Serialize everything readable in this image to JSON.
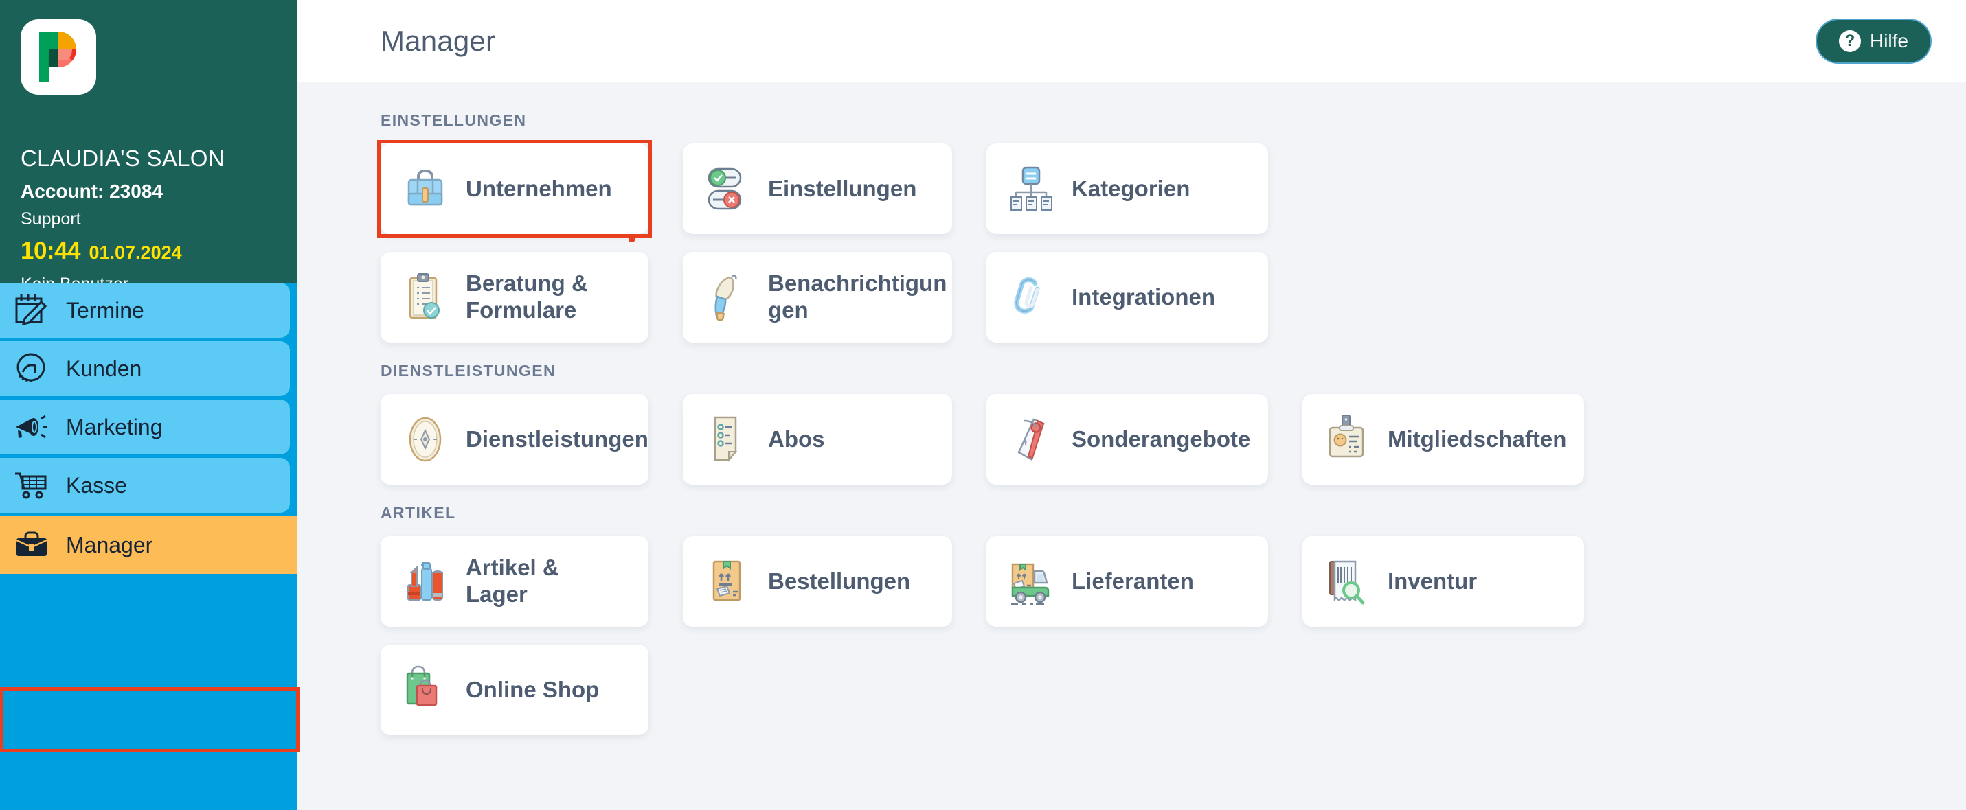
{
  "sidebar": {
    "logo_icon": "pocket-logo-icon",
    "business_name": "CLAUDIA'S SALON",
    "account_label": "Account: 23084",
    "support_label": "Support",
    "clock": "10:44",
    "date": "01.07.2024",
    "user_status": "Kein Benutzer",
    "nav_items": [
      {
        "label": "Termine",
        "icon": "calendar-edit-icon"
      },
      {
        "label": "Kunden",
        "icon": "customer-head-icon"
      },
      {
        "label": "Marketing",
        "icon": "megaphone-icon"
      },
      {
        "label": "Kasse",
        "icon": "shopping-cart-icon"
      },
      {
        "label": "Manager",
        "icon": "briefcase-icon",
        "active": true
      }
    ]
  },
  "header": {
    "title": "Manager",
    "help_label": "Hilfe",
    "help_icon": "question-circle-icon"
  },
  "sections": [
    {
      "title": "EINSTELLUNGEN",
      "rows": [
        [
          {
            "label": "Unternehmen",
            "icon": "briefcase-blue-icon",
            "width": "w-sm",
            "highlighted": true
          },
          {
            "label": "Einstellungen",
            "icon": "toggle-switches-icon",
            "width": "w-md"
          },
          {
            "label": "Kategorien",
            "icon": "hierarchy-tree-icon",
            "width": "w-lg"
          }
        ],
        [
          {
            "label": "Beratung & Formulare",
            "icon": "clipboard-check-icon",
            "width": "w-sm",
            "multiline": true
          },
          {
            "label": "Benachrichtigungen",
            "icon": "bell-brush-icon",
            "width": "w-md",
            "multiline": true
          },
          {
            "label": "Integrationen",
            "icon": "paperclip-icon",
            "width": "w-lg"
          }
        ]
      ]
    },
    {
      "title": "DIENSTLEISTUNGEN",
      "rows": [
        [
          {
            "label": "Dienstleistungen",
            "icon": "compass-icon",
            "width": "w-sm"
          },
          {
            "label": "Abos",
            "icon": "document-list-icon",
            "width": "w-md"
          },
          {
            "label": "Sonderangebote",
            "icon": "price-tag-icon",
            "width": "w-lg"
          },
          {
            "label": "Mitgliedschaften",
            "icon": "id-badge-icon",
            "width": "w-lg"
          }
        ]
      ]
    },
    {
      "title": "ARTIKEL",
      "rows": [
        [
          {
            "label": "Artikel & Lager",
            "icon": "cosmetics-icon",
            "width": "w-sm"
          },
          {
            "label": "Bestellungen",
            "icon": "shipping-box-icon",
            "width": "w-md"
          },
          {
            "label": "Lieferanten",
            "icon": "delivery-truck-icon",
            "width": "w-lg"
          },
          {
            "label": "Inventur",
            "icon": "receipt-search-icon",
            "width": "w-lg"
          }
        ],
        [
          {
            "label": "Online Shop",
            "icon": "shopping-bags-icon",
            "width": "w-sm"
          }
        ]
      ]
    }
  ],
  "colors": {
    "sidebar_header": "#1B6157",
    "sidebar_body": "#00A0DE",
    "nav_item": "#5BCBF5",
    "nav_active": "#FDBC55",
    "accent_yellow": "#FFE200",
    "annotation_red": "#E8401F",
    "text_slate": "#4E5C72",
    "content_bg": "#F2F4F7",
    "help_btn": "#1B6157"
  }
}
